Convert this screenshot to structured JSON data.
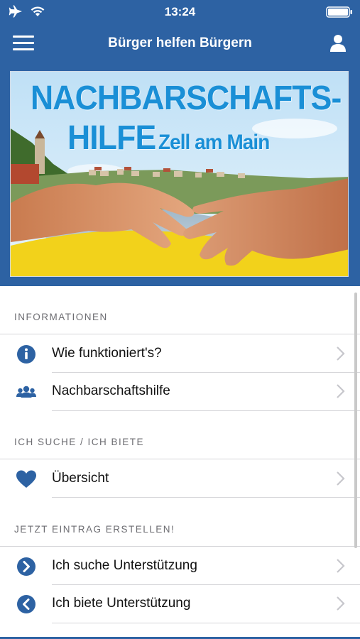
{
  "status_bar": {
    "time": "13:24",
    "airplane_icon": "airplane-icon",
    "wifi_icon": "wifi-icon",
    "battery_icon": "battery-icon"
  },
  "navbar": {
    "title": "Bürger helfen Bürgern",
    "menu_icon": "hamburger-menu-icon",
    "user_icon": "user-icon"
  },
  "banner": {
    "line1": "NACHBARSCHAFTS-",
    "line2_big": "HILFE",
    "line2_small": "Zell am Main"
  },
  "sections": [
    {
      "header": "INFORMATIONEN",
      "items": [
        {
          "label": "Wie funktioniert's?",
          "icon": "info-icon"
        },
        {
          "label": "Nachbarschaftshilfe",
          "icon": "group-icon"
        }
      ]
    },
    {
      "header": "ICH SUCHE / ICH BIETE",
      "items": [
        {
          "label": "Übersicht",
          "icon": "heart-icon"
        }
      ]
    },
    {
      "header": "JETZT EINTRAG ERSTELLEN!",
      "items": [
        {
          "label": "Ich suche Unterstützung",
          "icon": "chevron-right-circle-icon"
        },
        {
          "label": "Ich biete Unterstützung",
          "icon": "chevron-left-circle-icon"
        }
      ]
    }
  ],
  "colors": {
    "brand": "#2d62a3",
    "icon": "#2d62a3",
    "chevron": "#c7c7cc",
    "section_text": "#6d6d72"
  }
}
